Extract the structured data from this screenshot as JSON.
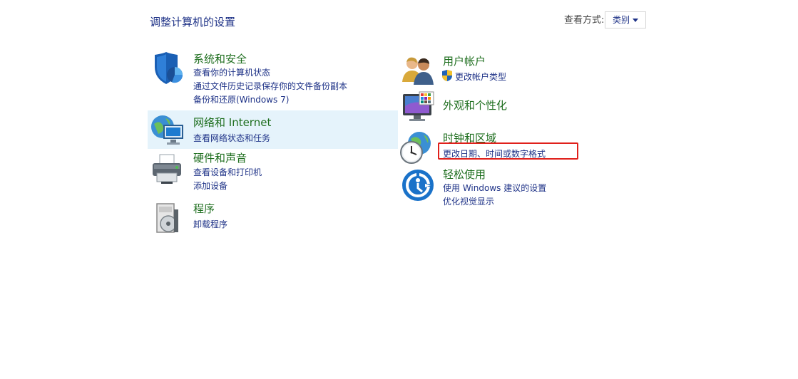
{
  "page_title": "调整计算机的设置",
  "view_by": {
    "label": "查看方式:",
    "selected": "类别"
  },
  "left": [
    {
      "title": "系统和安全",
      "links": [
        "查看你的计算机状态",
        "通过文件历史记录保存你的文件备份副本",
        "备份和还原(Windows 7)"
      ]
    },
    {
      "title": "网络和 Internet",
      "links": [
        "查看网络状态和任务"
      ]
    },
    {
      "title": "硬件和声音",
      "links": [
        "查看设备和打印机",
        "添加设备"
      ]
    },
    {
      "title": "程序",
      "links": [
        "卸载程序"
      ]
    }
  ],
  "right": [
    {
      "title": "用户帐户",
      "links": [
        "更改帐户类型"
      ]
    },
    {
      "title": "外观和个性化",
      "links": []
    },
    {
      "title": "时钟和区域",
      "links": [
        "更改日期、时间或数字格式"
      ]
    },
    {
      "title": "轻松使用",
      "links": [
        "使用 Windows 建议的设置",
        "优化视觉显示"
      ]
    }
  ],
  "icons": {
    "system_security": "shield-icon",
    "network": "globe-monitor-icon",
    "hardware": "printer-icon",
    "programs": "program-disc-icon",
    "user_accounts": "users-icon",
    "appearance": "monitor-palette-icon",
    "clock_region": "clock-globe-icon",
    "ease_of_access": "ease-of-access-icon"
  },
  "colors": {
    "title_green": "#1e6e1e",
    "link_blue": "#1e3287",
    "highlight_red": "#e0201b",
    "hover_bg": "#e5f3fb"
  }
}
